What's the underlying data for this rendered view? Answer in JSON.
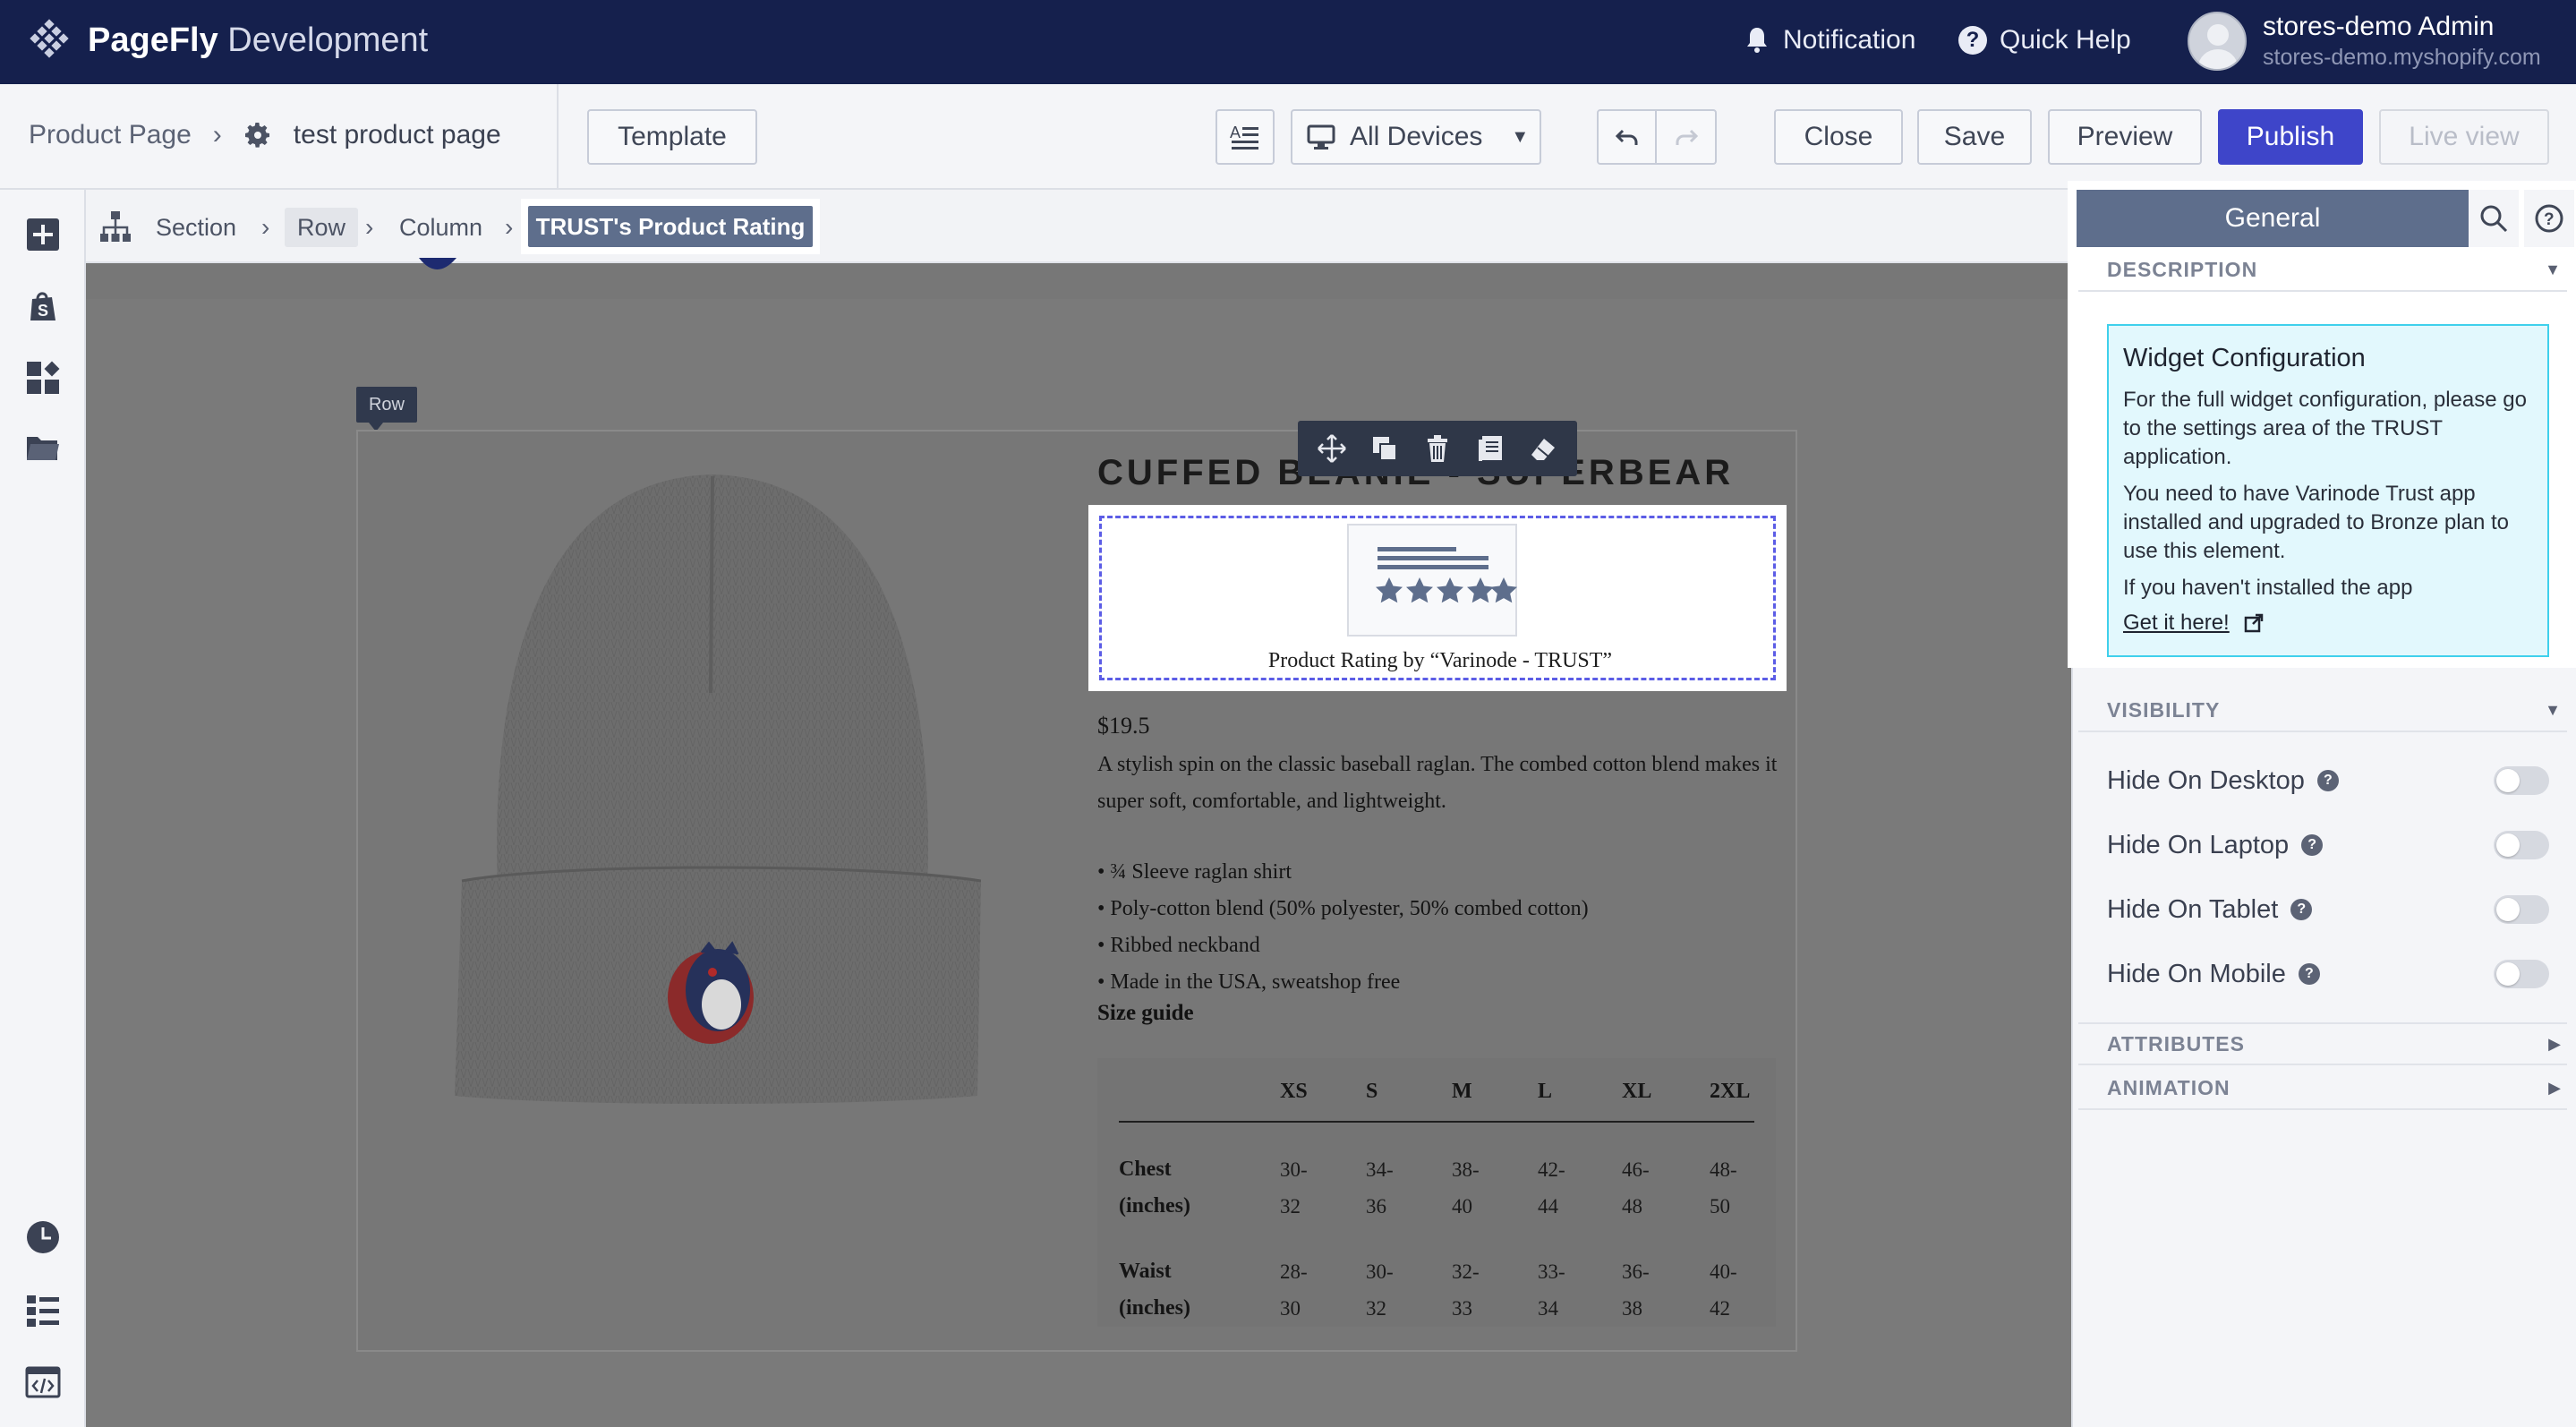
{
  "app": {
    "brand_bold": "PageFly",
    "brand_rest": " Development"
  },
  "topbar": {
    "notification_label": "Notification",
    "quick_help_label": "Quick Help",
    "user_name": "stores-demo Admin",
    "user_store": "stores-demo.myshopify.com"
  },
  "toolbar": {
    "page_type": "Product Page",
    "page_name": "test product page",
    "template_label": "Template",
    "device_label": "All Devices",
    "close_label": "Close",
    "save_label": "Save",
    "preview_label": "Preview",
    "publish_label": "Publish",
    "live_view_label": "Live view"
  },
  "breadcrumb": {
    "items": [
      "Section",
      "Row",
      "Column"
    ],
    "active": "TRUST's Product Rating"
  },
  "canvas": {
    "row_tag": "Row",
    "product_title": "CUFFED BEANIE - SUPERBEAR",
    "rating_caption": "Product Rating by “Varinode - TRUST”",
    "price": "$19.5",
    "description": "A stylish spin on the classic baseball raglan. The combed cotton blend makes it super soft, comfortable, and lightweight.",
    "bullets": [
      "• ¾ Sleeve raglan shirt",
      "• Poly-cotton blend (50% polyester, 50% combed cotton)",
      "• Ribbed neckband",
      "• Made in the USA, sweatshop free"
    ],
    "size_guide_label": "Size guide",
    "size_table": {
      "headers": [
        "XS",
        "S",
        "M",
        "L",
        "XL",
        "2XL"
      ],
      "rows": [
        {
          "label_line1": "Chest",
          "label_line2": "(inches)",
          "cells": [
            [
              "30-",
              "32"
            ],
            [
              "34-",
              "36"
            ],
            [
              "38-",
              "40"
            ],
            [
              "42-",
              "44"
            ],
            [
              "46-",
              "48"
            ],
            [
              "48-",
              "50"
            ]
          ]
        },
        {
          "label_line1": "Waist",
          "label_line2": "(inches)",
          "cells": [
            [
              "28-",
              "30"
            ],
            [
              "30-",
              "32"
            ],
            [
              "32-",
              "33"
            ],
            [
              "33-",
              "34"
            ],
            [
              "36-",
              "38"
            ],
            [
              "40-",
              "42"
            ]
          ]
        }
      ]
    }
  },
  "right_panel": {
    "tab_label": "General",
    "description_section": "DESCRIPTION",
    "widget_title": "Widget Configuration",
    "widget_p1": "For the full widget configuration, please go to the settings area of the TRUST application.",
    "widget_p2": "You need to have Varinode Trust app installed and upgraded to Bronze plan to use this element.",
    "widget_p3": "If you haven't installed the app",
    "widget_link": "Get it here!",
    "visibility_section": "VISIBILITY",
    "toggles": [
      {
        "label": "Hide On Desktop",
        "on": false
      },
      {
        "label": "Hide On Laptop",
        "on": false
      },
      {
        "label": "Hide On Tablet",
        "on": false
      },
      {
        "label": "Hide On Mobile",
        "on": false
      }
    ],
    "attributes_section": "ATTRIBUTES",
    "animation_section": "ANIMATION"
  },
  "colors": {
    "topbar_bg": "#15204d",
    "publish_bg": "#3e45c9",
    "active_tab": "#5e6e8c",
    "widget_box_bg": "#e2f8fd",
    "widget_box_border": "#3fd0ec"
  }
}
